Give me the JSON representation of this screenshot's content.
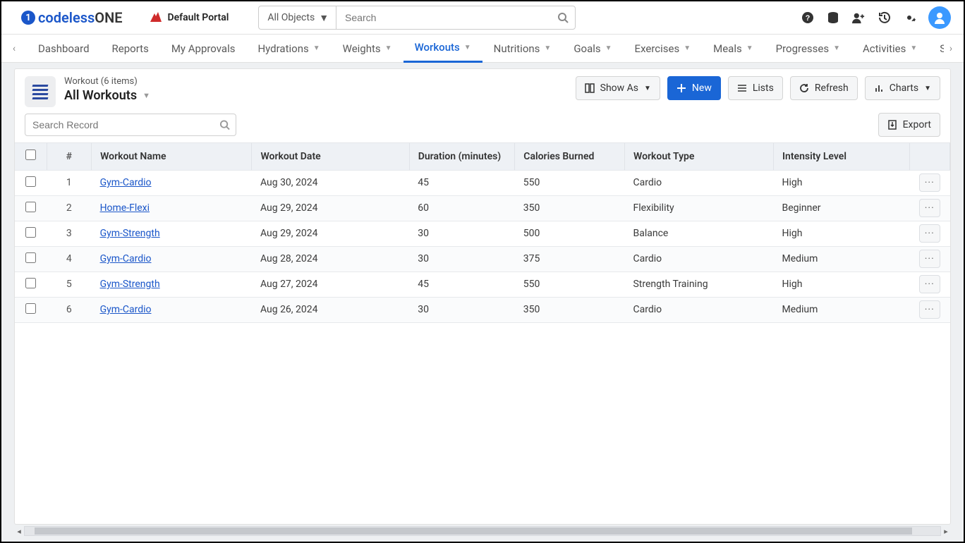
{
  "header": {
    "logo_part1": "codeless",
    "logo_part2": "ONE",
    "portal_label": "Default Portal",
    "combo_label": "All Objects",
    "search_placeholder": "Search"
  },
  "nav": {
    "items": [
      {
        "label": "Dashboard",
        "dd": false
      },
      {
        "label": "Reports",
        "dd": false
      },
      {
        "label": "My Approvals",
        "dd": false
      },
      {
        "label": "Hydrations",
        "dd": true
      },
      {
        "label": "Weights",
        "dd": true
      },
      {
        "label": "Workouts",
        "dd": true,
        "active": true
      },
      {
        "label": "Nutritions",
        "dd": true
      },
      {
        "label": "Goals",
        "dd": true
      },
      {
        "label": "Exercises",
        "dd": true
      },
      {
        "label": "Meals",
        "dd": true
      },
      {
        "label": "Progresses",
        "dd": true
      },
      {
        "label": "Activities",
        "dd": true
      },
      {
        "label": "Sleeps",
        "dd": false
      }
    ]
  },
  "panel": {
    "subtitle": "Workout (6 items)",
    "title": "All Workouts",
    "toolbar": {
      "show_as": "Show As",
      "new": "New",
      "lists": "Lists",
      "refresh": "Refresh",
      "charts": "Charts"
    },
    "search_placeholder": "Search Record",
    "export_label": "Export"
  },
  "table": {
    "columns": {
      "num": "#",
      "name": "Workout Name",
      "date": "Workout Date",
      "duration": "Duration (minutes)",
      "calories": "Calories Burned",
      "type": "Workout Type",
      "intensity": "Intensity Level"
    },
    "rows": [
      {
        "num": "1",
        "name": "Gym-Cardio",
        "date": "Aug 30, 2024",
        "duration": "45",
        "calories": "550",
        "type": "Cardio",
        "intensity": "High"
      },
      {
        "num": "2",
        "name": "Home-Flexi",
        "date": "Aug 29, 2024",
        "duration": "60",
        "calories": "350",
        "type": "Flexibility",
        "intensity": "Beginner"
      },
      {
        "num": "3",
        "name": "Gym-Strength",
        "date": "Aug 29, 2024",
        "duration": "30",
        "calories": "500",
        "type": "Balance",
        "intensity": "High"
      },
      {
        "num": "4",
        "name": "Gym-Cardio",
        "date": "Aug 28, 2024",
        "duration": "30",
        "calories": "375",
        "type": "Cardio",
        "intensity": "Medium"
      },
      {
        "num": "5",
        "name": "Gym-Strength",
        "date": "Aug 27, 2024",
        "duration": "45",
        "calories": "550",
        "type": "Strength Training",
        "intensity": "High"
      },
      {
        "num": "6",
        "name": "Gym-Cardio",
        "date": "Aug 26, 2024",
        "duration": "30",
        "calories": "350",
        "type": "Cardio",
        "intensity": "Medium"
      }
    ]
  }
}
